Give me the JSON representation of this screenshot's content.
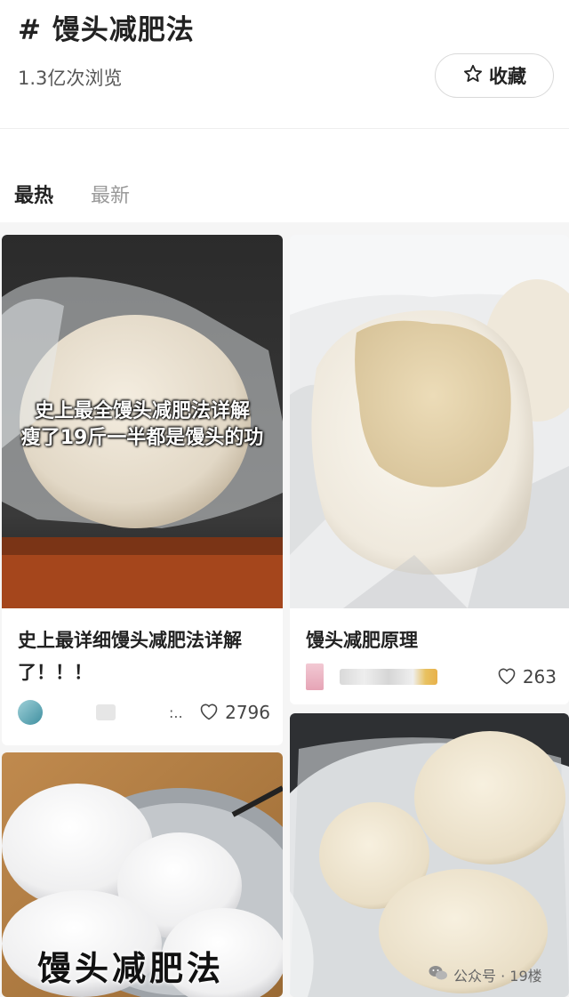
{
  "header": {
    "topic_title": "# 馒头减肥法",
    "views": "1.3亿次浏览",
    "favorite_label": "收藏"
  },
  "tabs": [
    {
      "label": "最热",
      "active": true
    },
    {
      "label": "最新",
      "active": false
    }
  ],
  "cards": [
    {
      "overlay_lines": [
        "史上最全馒头减肥法详解",
        "瘦了19斤一半都是馒头的功"
      ],
      "title": "史上最详细馒头减肥法详解了！！！",
      "author_suffix": ":..",
      "likes": "2796"
    },
    {
      "title": "馒头减肥原理",
      "likes": "263"
    },
    {
      "overlay_caption": "馒头减肥法"
    },
    {}
  ],
  "watermark": "公众号 · 19楼",
  "icons": {
    "favorite": "star-outline-icon",
    "like": "heart-outline-icon",
    "watermark": "wechat-icon"
  },
  "colors": {
    "title_text": "#222222",
    "inactive_tab": "#999999",
    "feed_background": "#f5f5f5"
  }
}
